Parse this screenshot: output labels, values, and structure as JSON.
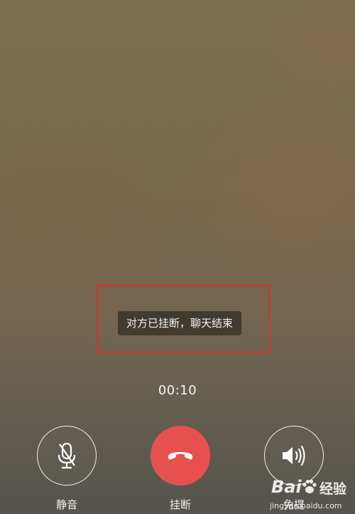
{
  "call": {
    "status_toast": "对方已挂断，聊天结束",
    "duration": "00:10"
  },
  "actions": {
    "mute": {
      "label": "静音",
      "icon": "muted-microphone-icon"
    },
    "hangup": {
      "label": "挂断",
      "icon": "phone-hangup-icon",
      "color": "#e65150"
    },
    "speaker": {
      "label": "免提",
      "icon": "speaker-icon"
    }
  },
  "annotation": {
    "highlight_color": "#d8302f"
  },
  "watermark": {
    "brand_part1": "Bai",
    "brand_part2": "du",
    "brand_suffix": "经验",
    "url": "jingyan.baidu.com"
  }
}
